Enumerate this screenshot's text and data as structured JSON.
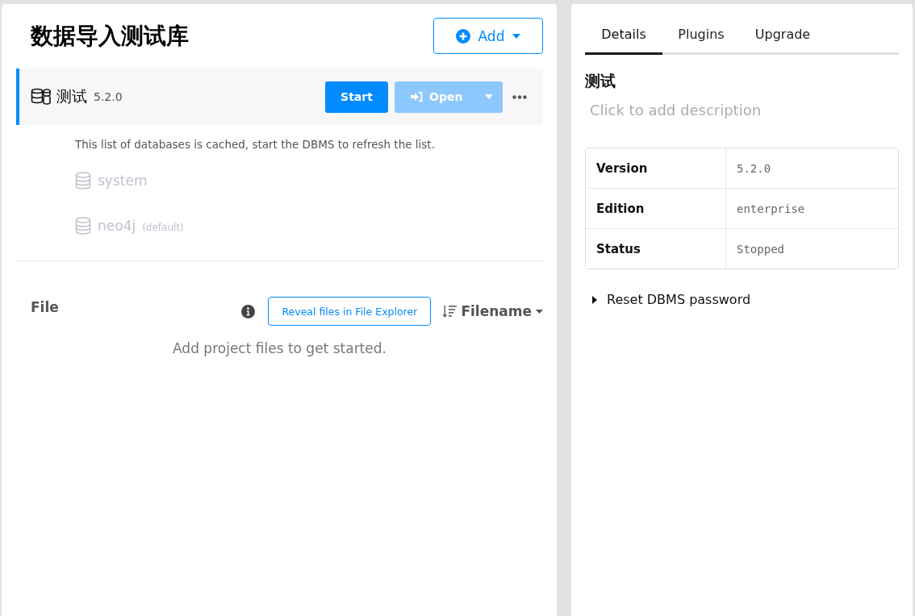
{
  "project": {
    "title": "数据导入测试库",
    "add_button": "Add"
  },
  "dbms": {
    "name": "测试",
    "version": "5.2.0",
    "selected": true,
    "start_button": "Start",
    "open_button": {
      "label": "Open",
      "disabled": true
    },
    "cache_note": "This list of databases is cached, start the DBMS to refresh the list.",
    "databases": [
      {
        "name": "system",
        "disabled": true
      },
      {
        "name": "neo4j",
        "tag": "(default)",
        "disabled": true
      }
    ]
  },
  "files": {
    "heading": "File",
    "reveal_button": "Reveal files in File Explorer",
    "sort": "Filename",
    "empty_message": "Add project files to get started."
  },
  "details": {
    "tabs": [
      {
        "label": "Details",
        "selected": true
      },
      {
        "label": "Plugins",
        "selected": false
      },
      {
        "label": "Upgrade",
        "selected": false
      }
    ],
    "name": "测试",
    "description_placeholder": "Click to add description",
    "table": [
      {
        "label": "Version",
        "value": "5.2.0"
      },
      {
        "label": "Edition",
        "value": "enterprise"
      },
      {
        "label": "Status",
        "value": "Stopped"
      }
    ],
    "reset_password": {
      "label": "Reset DBMS password",
      "expanded": false
    }
  }
}
